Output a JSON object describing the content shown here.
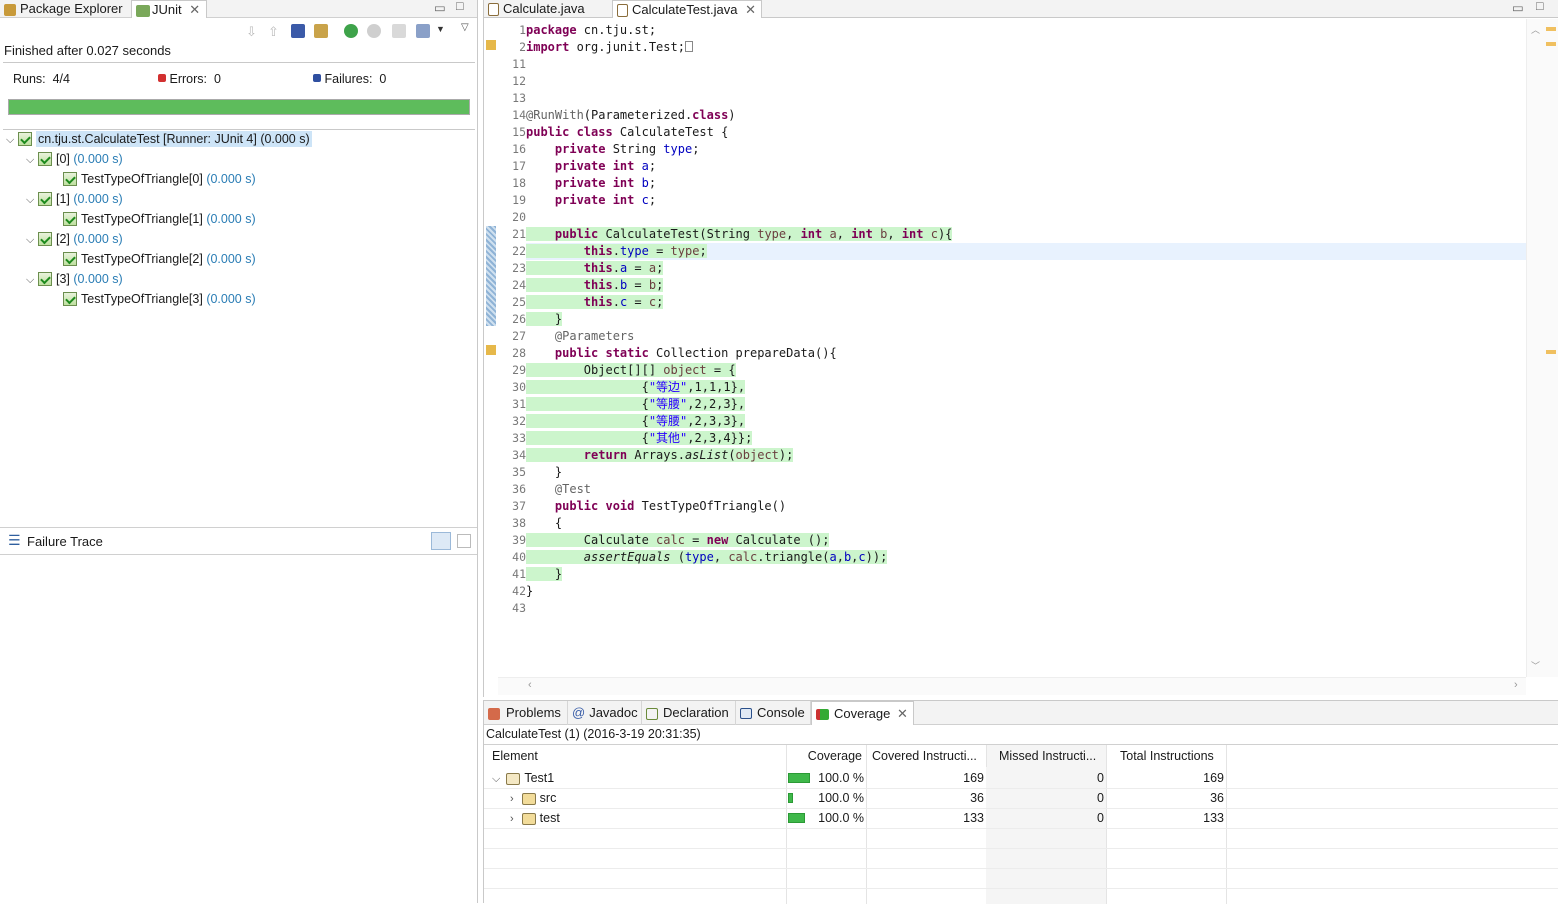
{
  "left": {
    "tabs": [
      {
        "label": "Package Explorer"
      },
      {
        "label": "JUnit"
      }
    ],
    "status": "Finished after 0.027 seconds",
    "runs_label": "Runs:",
    "runs_value": "4/4",
    "errors_label": "Errors:",
    "errors_value": "0",
    "failures_label": "Failures:",
    "failures_value": "0",
    "progress": 1.0,
    "tree": [
      {
        "label": "cn.tju.st.CalculateTest [Runner: JUnit 4] (0.000 s)"
      },
      {
        "label": "[0]",
        "time": "(0.000 s)"
      },
      {
        "label": "TestTypeOfTriangle[0]",
        "time": "(0.000 s)"
      },
      {
        "label": "[1]",
        "time": "(0.000 s)"
      },
      {
        "label": "TestTypeOfTriangle[1]",
        "time": "(0.000 s)"
      },
      {
        "label": "[2]",
        "time": "(0.000 s)"
      },
      {
        "label": "TestTypeOfTriangle[2]",
        "time": "(0.000 s)"
      },
      {
        "label": "[3]",
        "time": "(0.000 s)"
      },
      {
        "label": "TestTypeOfTriangle[3]",
        "time": "(0.000 s)"
      }
    ],
    "failure_trace": "Failure Trace"
  },
  "editor": {
    "tabs": [
      {
        "label": "Calculate.java"
      },
      {
        "label": "CalculateTest.java"
      }
    ],
    "line_numbers": [
      "1",
      "2",
      "11",
      "12",
      "13",
      "14",
      "15",
      "16",
      "17",
      "18",
      "19",
      "20",
      "21",
      "22",
      "23",
      "24",
      "25",
      "26",
      "27",
      "28",
      "29",
      "30",
      "31",
      "32",
      "33",
      "34",
      "35",
      "36",
      "37",
      "38",
      "39",
      "40",
      "41",
      "42",
      "43"
    ]
  },
  "bottom": {
    "tabs": [
      {
        "label": "Problems"
      },
      {
        "label": "Javadoc"
      },
      {
        "label": "Declaration"
      },
      {
        "label": "Console"
      },
      {
        "label": "Coverage"
      }
    ],
    "session": "CalculateTest (1) (2016-3-19 20:31:35)",
    "columns": [
      "Element",
      "Coverage",
      "Covered Instructi...",
      "Missed Instructi...",
      "Total Instructions"
    ],
    "rows": [
      {
        "element": "Test1",
        "coverage": "100.0 %",
        "covered": "169",
        "missed": "0",
        "total": "169"
      },
      {
        "element": "src",
        "coverage": "100.0 %",
        "covered": "36",
        "missed": "0",
        "total": "36"
      },
      {
        "element": "test",
        "coverage": "100.0 %",
        "covered": "133",
        "missed": "0",
        "total": "133"
      }
    ]
  }
}
